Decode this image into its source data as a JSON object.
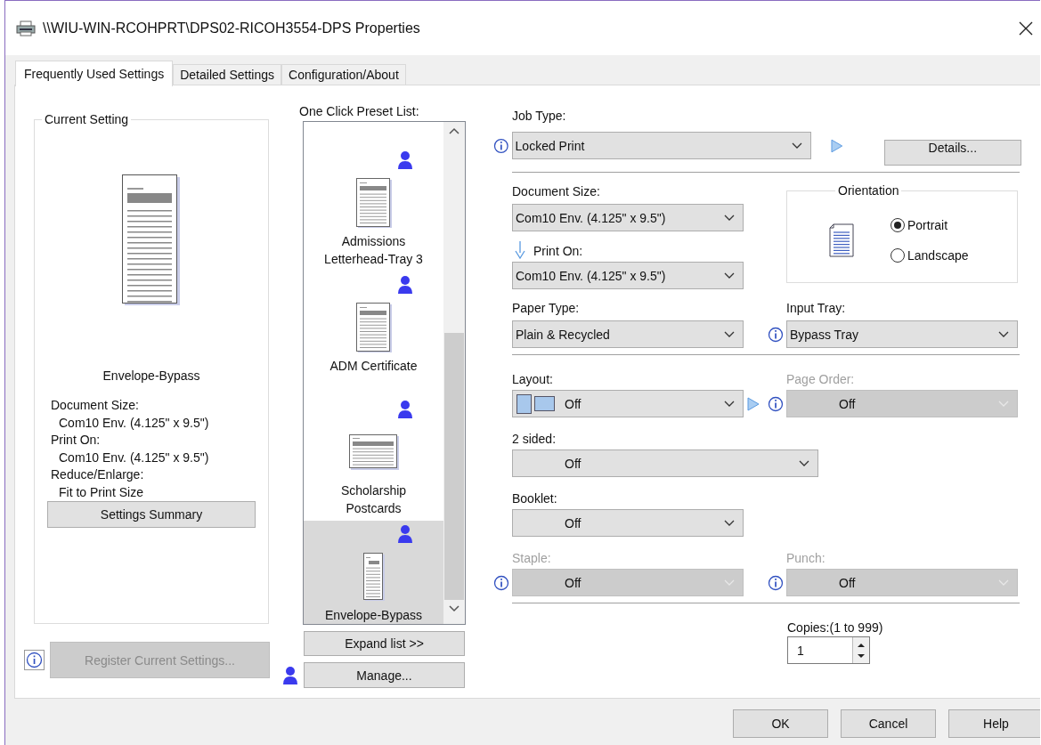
{
  "window": {
    "title": "\\\\WIU-WIN-RCOHPRT\\DPS02-RICOH3554-DPS Properties"
  },
  "tabs": [
    {
      "label": "Frequently Used Settings",
      "selected": true
    },
    {
      "label": "Detailed Settings",
      "selected": false
    },
    {
      "label": "Configuration/About",
      "selected": false
    }
  ],
  "current_setting": {
    "title": "Current Setting",
    "preset_name": "Envelope-Bypass",
    "details": [
      {
        "label": "Document Size:",
        "value": "Com10 Env. (4.125\" x 9.5\")"
      },
      {
        "label": "Print On:",
        "value": "Com10 Env. (4.125\" x 9.5\")"
      },
      {
        "label": "Reduce/Enlarge:",
        "value": "Fit to Print Size"
      }
    ],
    "summary_button": "Settings Summary"
  },
  "register_button": {
    "label": "Register Current Settings...",
    "disabled": true
  },
  "preset_list": {
    "label": "One Click Preset List:",
    "items": [
      {
        "name": "Admissions Letterhead-Tray 3",
        "kind": "portrait",
        "selected": false
      },
      {
        "name": "ADM Certificate",
        "kind": "portrait",
        "selected": false
      },
      {
        "name": "Scholarship Postcards",
        "kind": "landscape",
        "selected": false
      },
      {
        "name": "Envelope-Bypass",
        "kind": "envelope",
        "selected": true
      }
    ]
  },
  "expand_button": "Expand list >>",
  "manage_button": "Manage...",
  "job_type": {
    "label": "Job Type:",
    "value": "Locked Print",
    "disabled": false
  },
  "details_button": "Details...",
  "document_size": {
    "label": "Document Size:",
    "value": "Com10 Env. (4.125\" x 9.5\")",
    "disabled": false
  },
  "print_on": {
    "label": "Print On:",
    "value": "Com10 Env. (4.125\" x 9.5\")",
    "disabled": false
  },
  "orientation": {
    "title": "Orientation",
    "options": [
      {
        "label": "Portrait",
        "selected": true
      },
      {
        "label": "Landscape",
        "selected": false
      }
    ]
  },
  "paper_type": {
    "label": "Paper Type:",
    "value": "Plain & Recycled",
    "disabled": false
  },
  "input_tray": {
    "label": "Input Tray:",
    "value": "Bypass Tray",
    "disabled": false
  },
  "layout": {
    "label": "Layout:",
    "value": "Off",
    "kind": "layout",
    "disabled": false
  },
  "page_order": {
    "label": "Page Order:",
    "value": "Off",
    "kind": "option",
    "disabled": true
  },
  "two_sided": {
    "label": "2 sided:",
    "value": "Off",
    "kind": "option",
    "disabled": false
  },
  "booklet": {
    "label": "Booklet:",
    "value": "Off",
    "kind": "option",
    "disabled": false
  },
  "staple": {
    "label": "Staple:",
    "value": "Off",
    "kind": "option",
    "disabled": true
  },
  "punch": {
    "label": "Punch:",
    "value": "Off",
    "kind": "option",
    "disabled": true
  },
  "copies": {
    "label": "Copies:(1 to 999)",
    "value": "1"
  },
  "buttons": [
    "OK",
    "Cancel",
    "Help"
  ]
}
